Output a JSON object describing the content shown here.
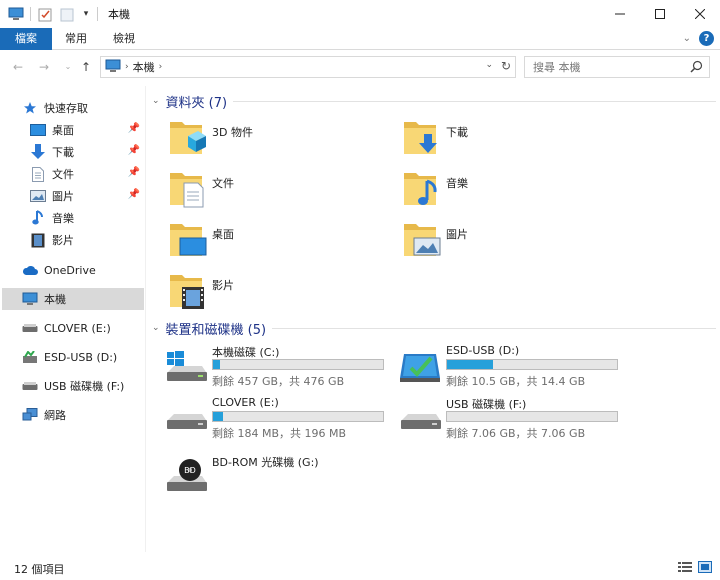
{
  "window": {
    "title": "本機",
    "controls": [
      "minimize",
      "maximize",
      "close"
    ]
  },
  "ribbon": {
    "tabs": [
      {
        "label": "檔案",
        "active": true
      },
      {
        "label": "常用",
        "active": false
      },
      {
        "label": "檢視",
        "active": false
      }
    ]
  },
  "address": {
    "crumbs": [
      "本機"
    ]
  },
  "search": {
    "placeholder": "搜尋 本機"
  },
  "sidebar": {
    "items": [
      {
        "label": "快速存取",
        "icon": "star-icon"
      },
      {
        "label": "桌面",
        "icon": "desktop-icon",
        "pinned": true
      },
      {
        "label": "下載",
        "icon": "download-arrow-icon",
        "pinned": true
      },
      {
        "label": "文件",
        "icon": "document-icon",
        "pinned": true
      },
      {
        "label": "圖片",
        "icon": "picture-icon",
        "pinned": true
      },
      {
        "label": "音樂",
        "icon": "music-note-icon"
      },
      {
        "label": "影片",
        "icon": "film-icon"
      },
      {
        "label": "OneDrive",
        "icon": "cloud-icon"
      },
      {
        "label": "本機",
        "icon": "computer-icon",
        "selected": true
      },
      {
        "label": "CLOVER (E:)",
        "icon": "drive-icon"
      },
      {
        "label": "ESD-USB (D:)",
        "icon": "usb-drive-icon"
      },
      {
        "label": "USB 磁碟機 (F:)",
        "icon": "drive-icon"
      },
      {
        "label": "網路",
        "icon": "network-icon"
      }
    ]
  },
  "folders_group": {
    "title": "資料夾 (7)",
    "items": [
      {
        "label": "3D 物件",
        "icon": "3d-objects-folder-icon"
      },
      {
        "label": "下載",
        "icon": "downloads-folder-icon"
      },
      {
        "label": "文件",
        "icon": "documents-folder-icon"
      },
      {
        "label": "音樂",
        "icon": "music-folder-icon"
      },
      {
        "label": "桌面",
        "icon": "desktop-folder-icon"
      },
      {
        "label": "圖片",
        "icon": "pictures-folder-icon"
      },
      {
        "label": "影片",
        "icon": "videos-folder-icon"
      }
    ]
  },
  "drives_group": {
    "title": "裝置和磁碟機 (5)",
    "items": [
      {
        "name": "本機磁碟 (C:)",
        "info": "剩餘 457 GB，共 476 GB",
        "used_fraction": 0.04,
        "icon": "windows-drive-icon"
      },
      {
        "name": "ESD-USB (D:)",
        "info": "剩餘 10.5 GB，共 14.4 GB",
        "used_fraction": 0.27,
        "icon": "usb-install-drive-icon"
      },
      {
        "name": "CLOVER (E:)",
        "info": "剩餘 184 MB，共 196 MB",
        "used_fraction": 0.06,
        "icon": "drive-icon"
      },
      {
        "name": "USB 磁碟機 (F:)",
        "info": "剩餘 7.06 GB，共 7.06 GB",
        "used_fraction": 0.0,
        "icon": "drive-icon"
      },
      {
        "name": "BD-ROM 光碟機 (G:)",
        "info": "",
        "icon": "bd-rom-icon"
      }
    ]
  },
  "status": {
    "count": "12 個項目"
  },
  "colors": {
    "accent": "#1a6bb8",
    "bar_fill": "#26a0da",
    "group_title": "#1e3287",
    "selected": "#d9d9d9",
    "folder": "#f8d775"
  }
}
